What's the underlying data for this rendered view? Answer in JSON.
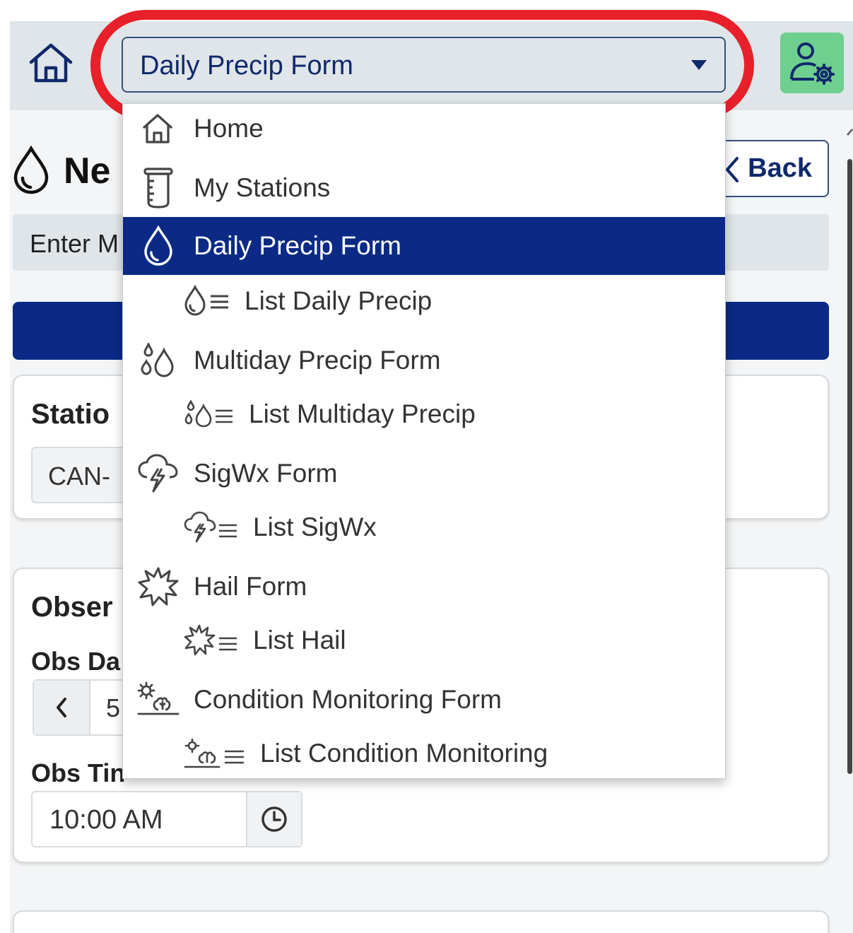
{
  "header": {
    "nav_selected": "Daily Precip Form",
    "home_icon": "home-icon",
    "user_settings_icon": "user-settings-icon",
    "user_button_color": "#6fcf8f"
  },
  "page": {
    "title_partial": "Ne",
    "back_label": "Back",
    "manual_entry_partial": "Enter M",
    "primary_color": "#0a2a85",
    "highlight_color": "#e8202a"
  },
  "station_card": {
    "title_partial": "Statio",
    "station_value_partial": "CAN-"
  },
  "observation_card": {
    "title_partial": "Obser",
    "obs_date_label_partial": "Obs Da",
    "obs_date_value_partial": "5,",
    "obs_time_label_partial": "Obs Tin",
    "obs_time_value": "10:00 AM"
  },
  "menu": {
    "items": [
      {
        "label": "Home",
        "icon": "home-icon",
        "sub": false,
        "active": false
      },
      {
        "label": "My Stations",
        "icon": "rain-gauge-icon",
        "sub": false,
        "active": false
      },
      {
        "label": "Daily Precip Form",
        "icon": "droplet-icon",
        "sub": false,
        "active": true
      },
      {
        "label": "List Daily Precip",
        "icon": "droplet-list-icon",
        "sub": true,
        "active": false
      },
      {
        "label": "Multiday Precip Form",
        "icon": "droplets-icon",
        "sub": false,
        "active": false
      },
      {
        "label": "List Multiday Precip",
        "icon": "droplets-list-icon",
        "sub": true,
        "active": false
      },
      {
        "label": "SigWx Form",
        "icon": "storm-cloud-icon",
        "sub": false,
        "active": false
      },
      {
        "label": "List SigWx",
        "icon": "storm-cloud-list-icon",
        "sub": true,
        "active": false
      },
      {
        "label": "Hail Form",
        "icon": "hail-burst-icon",
        "sub": false,
        "active": false
      },
      {
        "label": "List Hail",
        "icon": "hail-burst-list-icon",
        "sub": true,
        "active": false
      },
      {
        "label": "Condition Monitoring Form",
        "icon": "condition-monitoring-icon",
        "sub": false,
        "active": false
      },
      {
        "label": "List Condition Monitoring",
        "icon": "condition-monitoring-list-icon",
        "sub": true,
        "active": false
      }
    ]
  }
}
